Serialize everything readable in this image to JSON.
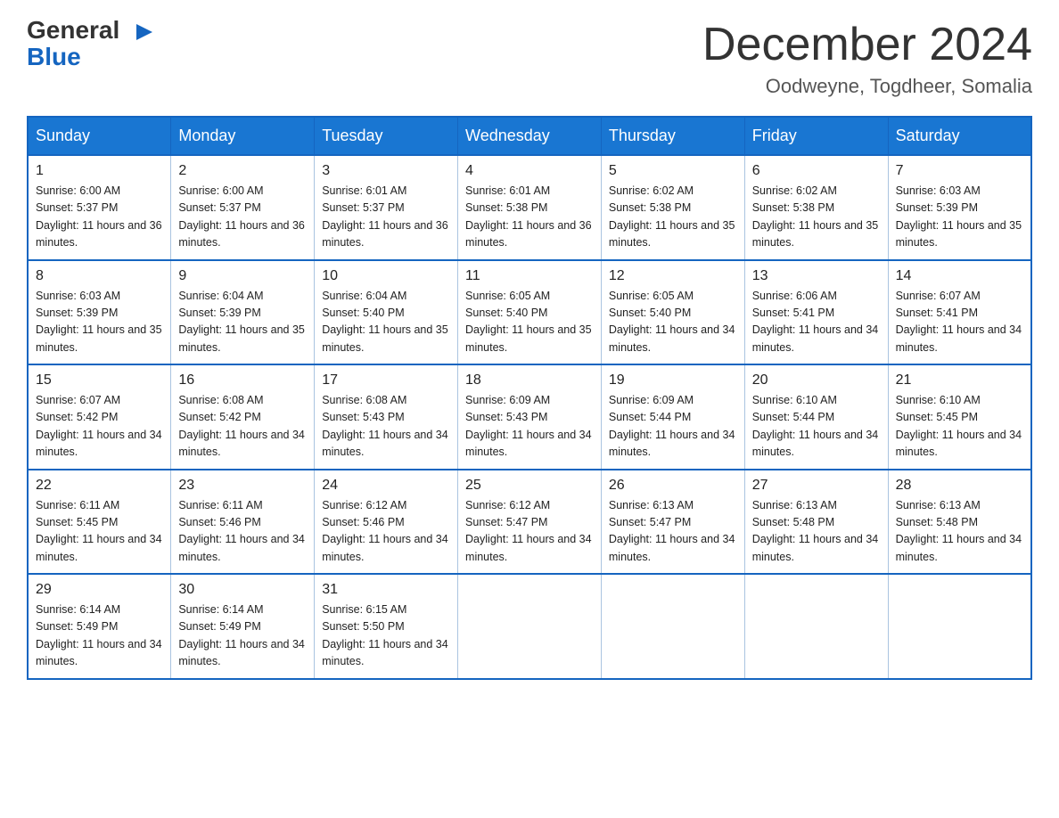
{
  "header": {
    "logo_line1": "General",
    "logo_line2": "Blue",
    "month": "December 2024",
    "location": "Oodweyne, Togdheer, Somalia"
  },
  "weekdays": [
    "Sunday",
    "Monday",
    "Tuesday",
    "Wednesday",
    "Thursday",
    "Friday",
    "Saturday"
  ],
  "weeks": [
    [
      {
        "day": "1",
        "sunrise": "6:00 AM",
        "sunset": "5:37 PM",
        "daylight": "11 hours and 36 minutes."
      },
      {
        "day": "2",
        "sunrise": "6:00 AM",
        "sunset": "5:37 PM",
        "daylight": "11 hours and 36 minutes."
      },
      {
        "day": "3",
        "sunrise": "6:01 AM",
        "sunset": "5:37 PM",
        "daylight": "11 hours and 36 minutes."
      },
      {
        "day": "4",
        "sunrise": "6:01 AM",
        "sunset": "5:38 PM",
        "daylight": "11 hours and 36 minutes."
      },
      {
        "day": "5",
        "sunrise": "6:02 AM",
        "sunset": "5:38 PM",
        "daylight": "11 hours and 35 minutes."
      },
      {
        "day": "6",
        "sunrise": "6:02 AM",
        "sunset": "5:38 PM",
        "daylight": "11 hours and 35 minutes."
      },
      {
        "day": "7",
        "sunrise": "6:03 AM",
        "sunset": "5:39 PM",
        "daylight": "11 hours and 35 minutes."
      }
    ],
    [
      {
        "day": "8",
        "sunrise": "6:03 AM",
        "sunset": "5:39 PM",
        "daylight": "11 hours and 35 minutes."
      },
      {
        "day": "9",
        "sunrise": "6:04 AM",
        "sunset": "5:39 PM",
        "daylight": "11 hours and 35 minutes."
      },
      {
        "day": "10",
        "sunrise": "6:04 AM",
        "sunset": "5:40 PM",
        "daylight": "11 hours and 35 minutes."
      },
      {
        "day": "11",
        "sunrise": "6:05 AM",
        "sunset": "5:40 PM",
        "daylight": "11 hours and 35 minutes."
      },
      {
        "day": "12",
        "sunrise": "6:05 AM",
        "sunset": "5:40 PM",
        "daylight": "11 hours and 34 minutes."
      },
      {
        "day": "13",
        "sunrise": "6:06 AM",
        "sunset": "5:41 PM",
        "daylight": "11 hours and 34 minutes."
      },
      {
        "day": "14",
        "sunrise": "6:07 AM",
        "sunset": "5:41 PM",
        "daylight": "11 hours and 34 minutes."
      }
    ],
    [
      {
        "day": "15",
        "sunrise": "6:07 AM",
        "sunset": "5:42 PM",
        "daylight": "11 hours and 34 minutes."
      },
      {
        "day": "16",
        "sunrise": "6:08 AM",
        "sunset": "5:42 PM",
        "daylight": "11 hours and 34 minutes."
      },
      {
        "day": "17",
        "sunrise": "6:08 AM",
        "sunset": "5:43 PM",
        "daylight": "11 hours and 34 minutes."
      },
      {
        "day": "18",
        "sunrise": "6:09 AM",
        "sunset": "5:43 PM",
        "daylight": "11 hours and 34 minutes."
      },
      {
        "day": "19",
        "sunrise": "6:09 AM",
        "sunset": "5:44 PM",
        "daylight": "11 hours and 34 minutes."
      },
      {
        "day": "20",
        "sunrise": "6:10 AM",
        "sunset": "5:44 PM",
        "daylight": "11 hours and 34 minutes."
      },
      {
        "day": "21",
        "sunrise": "6:10 AM",
        "sunset": "5:45 PM",
        "daylight": "11 hours and 34 minutes."
      }
    ],
    [
      {
        "day": "22",
        "sunrise": "6:11 AM",
        "sunset": "5:45 PM",
        "daylight": "11 hours and 34 minutes."
      },
      {
        "day": "23",
        "sunrise": "6:11 AM",
        "sunset": "5:46 PM",
        "daylight": "11 hours and 34 minutes."
      },
      {
        "day": "24",
        "sunrise": "6:12 AM",
        "sunset": "5:46 PM",
        "daylight": "11 hours and 34 minutes."
      },
      {
        "day": "25",
        "sunrise": "6:12 AM",
        "sunset": "5:47 PM",
        "daylight": "11 hours and 34 minutes."
      },
      {
        "day": "26",
        "sunrise": "6:13 AM",
        "sunset": "5:47 PM",
        "daylight": "11 hours and 34 minutes."
      },
      {
        "day": "27",
        "sunrise": "6:13 AM",
        "sunset": "5:48 PM",
        "daylight": "11 hours and 34 minutes."
      },
      {
        "day": "28",
        "sunrise": "6:13 AM",
        "sunset": "5:48 PM",
        "daylight": "11 hours and 34 minutes."
      }
    ],
    [
      {
        "day": "29",
        "sunrise": "6:14 AM",
        "sunset": "5:49 PM",
        "daylight": "11 hours and 34 minutes."
      },
      {
        "day": "30",
        "sunrise": "6:14 AM",
        "sunset": "5:49 PM",
        "daylight": "11 hours and 34 minutes."
      },
      {
        "day": "31",
        "sunrise": "6:15 AM",
        "sunset": "5:50 PM",
        "daylight": "11 hours and 34 minutes."
      },
      null,
      null,
      null,
      null
    ]
  ]
}
